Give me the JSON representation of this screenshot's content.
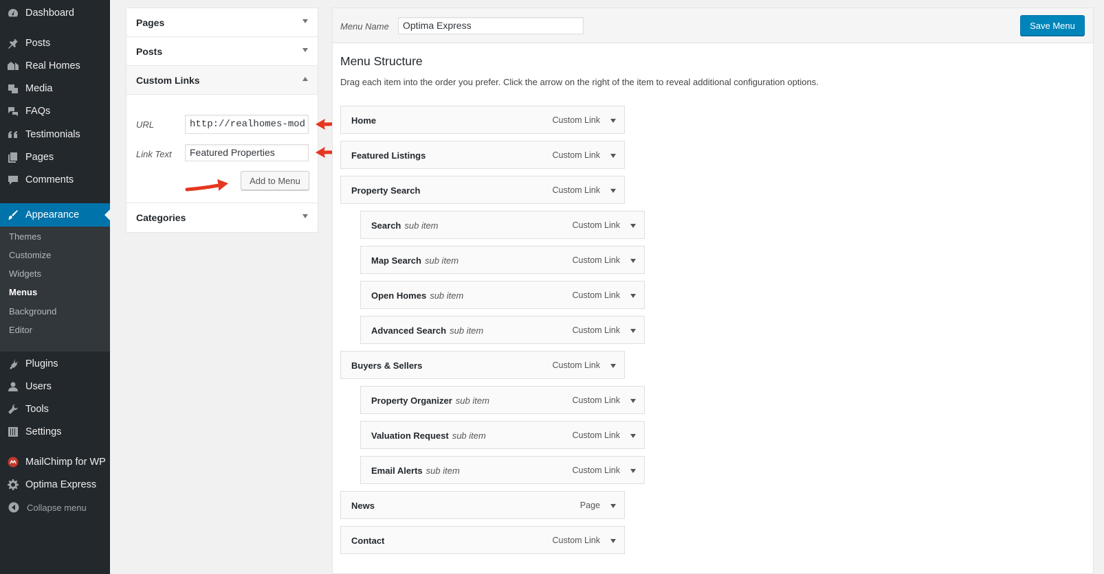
{
  "sidebar": {
    "top_items": [
      {
        "label": "Dashboard",
        "icon": "dashboard-icon"
      },
      {
        "label": "Posts",
        "icon": "pin-icon"
      },
      {
        "label": "Real Homes",
        "icon": "houses-icon"
      },
      {
        "label": "Media",
        "icon": "media-icon"
      },
      {
        "label": "FAQs",
        "icon": "speech-bubbles-icon"
      },
      {
        "label": "Testimonials",
        "icon": "quote-icon"
      },
      {
        "label": "Pages",
        "icon": "pages-icon"
      },
      {
        "label": "Comments",
        "icon": "comment-icon"
      }
    ],
    "appearance": {
      "label": "Appearance",
      "icon": "paintbrush-icon"
    },
    "appearance_sub": [
      "Themes",
      "Customize",
      "Widgets",
      "Menus",
      "Background",
      "Editor"
    ],
    "current_sub": "Menus",
    "bottom_items": [
      {
        "label": "Plugins",
        "icon": "plug-icon"
      },
      {
        "label": "Users",
        "icon": "user-icon"
      },
      {
        "label": "Tools",
        "icon": "wrench-icon"
      },
      {
        "label": "Settings",
        "icon": "sliders-icon"
      },
      {
        "label": "MailChimp for WP",
        "icon": "mailchimp-icon"
      },
      {
        "label": "Optima Express",
        "icon": "gear-icon"
      }
    ],
    "collapse_label": "Collapse menu",
    "colors": {
      "bg": "#23282d",
      "active": "#0073aa",
      "submenu_bg": "#32373c"
    }
  },
  "accordion": {
    "sections": [
      "Pages",
      "Posts",
      "Custom Links",
      "Categories"
    ],
    "custom_links": {
      "url_label": "URL",
      "url_value": "http://realhomes-mod",
      "link_text_label": "Link Text",
      "link_text_value": "Featured Properties",
      "add_button": "Add to Menu"
    }
  },
  "menu_editor": {
    "menu_name_label": "Menu Name",
    "menu_name_value": "Optima Express",
    "save_button": "Save Menu",
    "structure_title": "Menu Structure",
    "structure_desc": "Drag each item into the order you prefer. Click the arrow on the right of the item to reveal additional configuration options.",
    "items": [
      {
        "title": "Home",
        "sub": "",
        "type": "Custom Link",
        "depth": 0
      },
      {
        "title": "Featured Listings",
        "sub": "",
        "type": "Custom Link",
        "depth": 0
      },
      {
        "title": "Property Search",
        "sub": "",
        "type": "Custom Link",
        "depth": 0
      },
      {
        "title": "Search",
        "sub": "sub item",
        "type": "Custom Link",
        "depth": 1
      },
      {
        "title": "Map Search",
        "sub": "sub item",
        "type": "Custom Link",
        "depth": 1
      },
      {
        "title": "Open Homes",
        "sub": "sub item",
        "type": "Custom Link",
        "depth": 1
      },
      {
        "title": "Advanced Search",
        "sub": "sub item",
        "type": "Custom Link",
        "depth": 1
      },
      {
        "title": "Buyers & Sellers",
        "sub": "",
        "type": "Custom Link",
        "depth": 0
      },
      {
        "title": "Property Organizer",
        "sub": "sub item",
        "type": "Custom Link",
        "depth": 1
      },
      {
        "title": "Valuation Request",
        "sub": "sub item",
        "type": "Custom Link",
        "depth": 1
      },
      {
        "title": "Email Alerts",
        "sub": "sub item",
        "type": "Custom Link",
        "depth": 1
      },
      {
        "title": "News",
        "sub": "",
        "type": "Page",
        "depth": 0
      },
      {
        "title": "Contact",
        "sub": "",
        "type": "Custom Link",
        "depth": 0
      }
    ],
    "colors": {
      "primary_button": "#0085ba"
    }
  }
}
